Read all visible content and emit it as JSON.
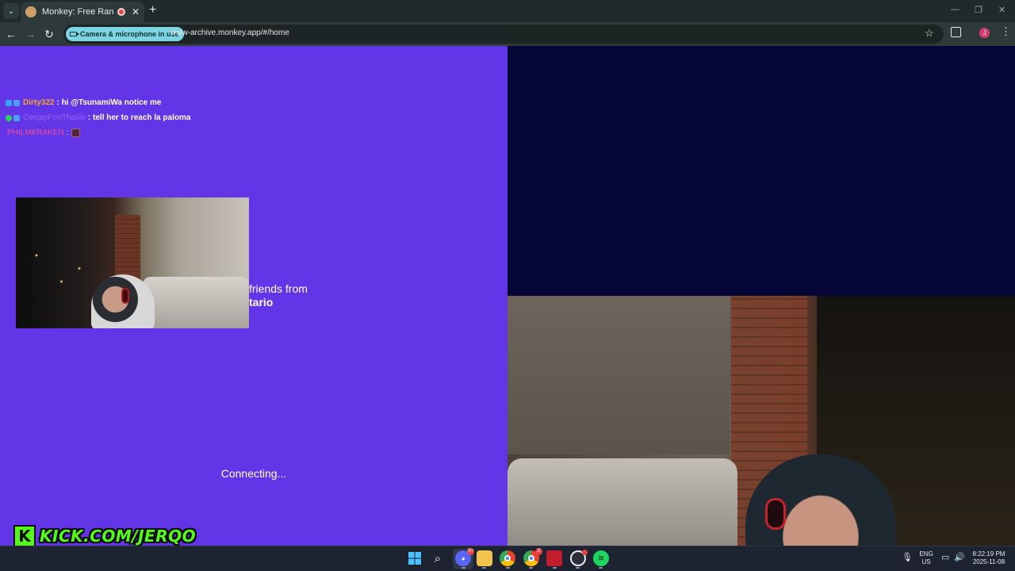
{
  "browser": {
    "tab_title": "Monkey: Free Random Video Chat",
    "new_tab_label": "+",
    "tab_close_label": "✕",
    "camera_chip": "Camera & microphone in use",
    "url": "www-archive.monkey.app/#/home",
    "profile_initial": "J",
    "window_controls": {
      "minimize": "—",
      "restore": "❐",
      "close": "✕"
    },
    "icons": [
      "tab-search-icon",
      "back-arrow-icon",
      "forward-arrow-icon",
      "reload-icon",
      "camera-icon",
      "bookmark-star-icon",
      "extensions-icon",
      "menu-icon"
    ]
  },
  "chat": {
    "messages": [
      {
        "user": "Dirty322",
        "user_color": "#f2a33a",
        "text": ": hi @TsunamiWa notice me",
        "badges": [
          "#3aa0ff",
          "#4a9cff"
        ]
      },
      {
        "user": "CeejayFrmTha6ix",
        "user_color": "#9a63f0",
        "text": ": tell her to reach la paloma",
        "badges": [
          "#2fd35a",
          "#4a9cff"
        ]
      },
      {
        "user": "PHILMKRAKEN",
        "user_color": "#f04ea0",
        "text": ":",
        "badges": [],
        "emote": "emote-icon"
      }
    ]
  },
  "main": {
    "friends_line1": "friends from",
    "friends_line2": "tario",
    "status": "Connecting..."
  },
  "overlay": {
    "kick_letter": "K",
    "kick_url": "KICK.COM/JERQO"
  },
  "colors": {
    "left_bg": "#6236e6",
    "right_top_bg": "#050536",
    "kick_green": "#53fc18"
  },
  "taskbar": {
    "discord_badge": "5+",
    "chrome2_badge": "2",
    "lang_line1": "ENG",
    "lang_line2": "US",
    "time": "8:22:19 PM",
    "date": "2025-11-08",
    "apps": [
      "windows-start-icon",
      "search-icon",
      "discord-icon",
      "file-explorer-icon",
      "chrome-icon",
      "chrome-profile-icon",
      "video-editor-icon",
      "obs-icon",
      "spotify-icon"
    ]
  }
}
